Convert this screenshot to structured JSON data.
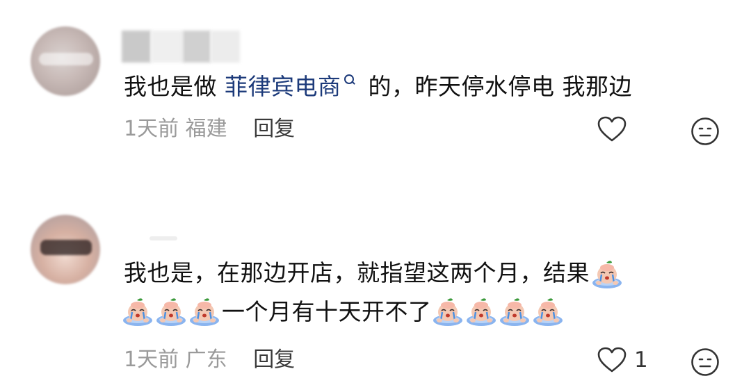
{
  "comments": [
    {
      "text_prefix": "我也是做 ",
      "link_text": "菲律宾电商",
      "text_suffix": " 的，昨天停水停电 我那边",
      "time": "1天前",
      "location": "福建",
      "reply_label": "回复",
      "like_count": ""
    },
    {
      "text_line1": "我也是，在那边开店，就指望这两个月，结果",
      "text_line2": "一个月有十天开不了",
      "time": "1天前",
      "location": "广东",
      "reply_label": "回复",
      "like_count": "1"
    }
  ],
  "icons": {
    "like": "heart-outline-icon",
    "emoji": "neutral-face-icon",
    "search": "search-icon",
    "sticker": "crying-peach-sticker"
  },
  "colors": {
    "link": "#1c3a7a",
    "meta": "#9a9a9a",
    "reply": "#3a3a3a"
  }
}
